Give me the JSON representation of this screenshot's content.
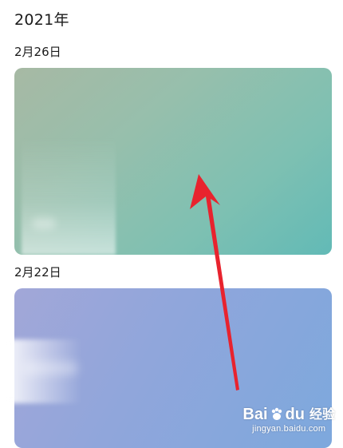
{
  "gallery": {
    "year": "2021年",
    "groups": [
      {
        "date": "2月26日"
      },
      {
        "date": "2月22日"
      }
    ]
  },
  "colors": {
    "arrow": "#e8232e",
    "card1": "#7ec0b2",
    "card2": "#8aa7dc"
  },
  "watermark": {
    "brand_left": "Bai",
    "brand_right": "du",
    "brand_cn": "经验",
    "url": "jingyan.baidu.com"
  }
}
